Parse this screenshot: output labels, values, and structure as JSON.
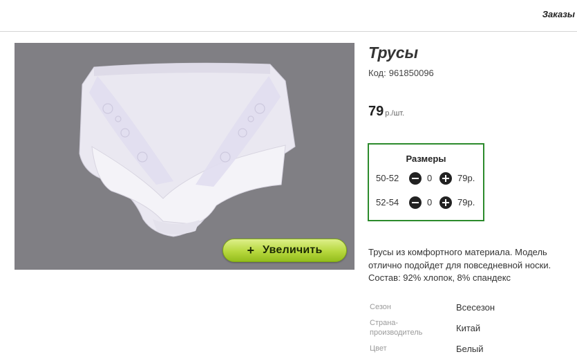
{
  "header": {
    "orders_link": "Заказы"
  },
  "gallery": {
    "zoom_label": "Увеличить",
    "zoom_plus": "+"
  },
  "product": {
    "title": "Трусы",
    "code_label": "Код:",
    "code_value": "961850096",
    "price": "79",
    "price_unit": "р./шт."
  },
  "sizes": {
    "header": "Размеры",
    "rows": [
      {
        "size": "50-52",
        "qty": "0",
        "price": "79р."
      },
      {
        "size": "52-54",
        "qty": "0",
        "price": "79р."
      }
    ]
  },
  "description": "Трусы из комфортного материала. Модель отлично подойдет для повседневной носки. Состав: 92% хлопок, 8% спандекс",
  "attributes": [
    {
      "key": "Сезон",
      "value": "Всесезон"
    },
    {
      "key": "Страна-производитель",
      "value": "Китай"
    },
    {
      "key": "Цвет",
      "value": "Белый"
    }
  ],
  "colors": {
    "accent_green": "#2b8a2b",
    "zoom_button": "#b7d83e",
    "photo_bg": "#807f84"
  }
}
